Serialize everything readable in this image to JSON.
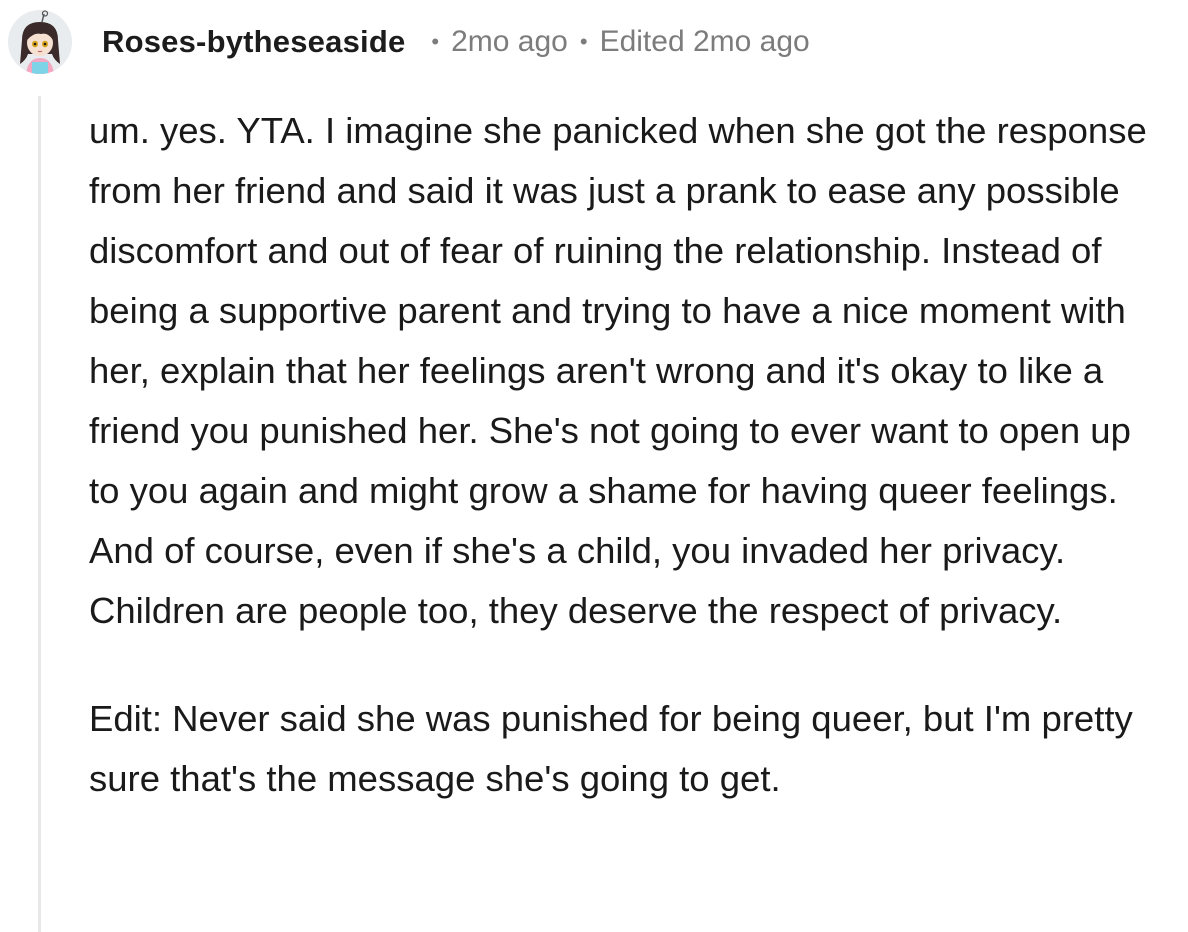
{
  "comment": {
    "author": "Roses-bytheseaside",
    "separator": "•",
    "timestamp": "2mo ago",
    "edited": "Edited 2mo ago",
    "avatar_icon": "avatar-icon",
    "paragraphs": [
      "um. yes. YTA. I imagine she panicked when she got the response from her friend and said it was just a prank to ease any possible discomfort and out of fear of ruining the relationship. Instead of being a supportive parent and trying to have a nice moment with her, explain that her feelings aren't wrong and it's okay to like a friend you punished her. She's not going to ever want to open up to you again and might grow a shame for having queer feelings. And of course, even if she's a child, you invaded her privacy. Children are people too, they deserve the respect of privacy.",
      "Edit: Never said she was punished for being queer, but I'm pretty sure that's the message she's going to get."
    ]
  },
  "colors": {
    "text": "#1a1a1b",
    "meta": "#7c7c7c",
    "thread_line": "#e7e7e7",
    "background": "#ffffff"
  }
}
